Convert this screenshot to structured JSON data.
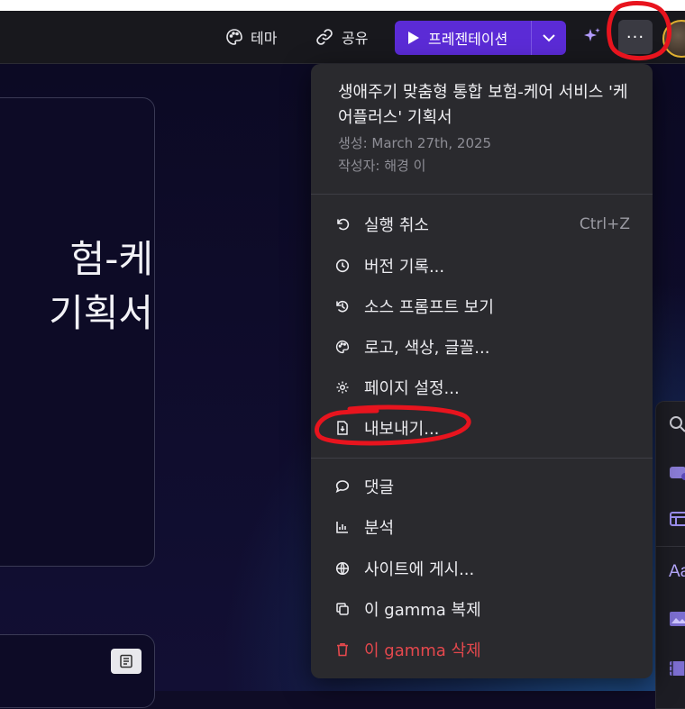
{
  "toolbar": {
    "theme_label": "테마",
    "share_label": "공유",
    "present_label": "프레젠테이션",
    "more_label": "···"
  },
  "slide": {
    "title_line1": "험-케",
    "title_line2": "기획서"
  },
  "menu": {
    "title": "생애주기 맞춤형 통합 보험-케어 서비스 '케어플러스' 기획서",
    "created": "생성: March 27th, 2025",
    "author": "작성자: 해경 이",
    "items": [
      {
        "label": "실행 취소",
        "shortcut": "Ctrl+Z",
        "icon": "undo-icon"
      },
      {
        "label": "버전 기록...",
        "icon": "clock-icon"
      },
      {
        "label": "소스 프롬프트 보기",
        "icon": "history-icon"
      },
      {
        "label": "로고, 색상, 글꼴...",
        "icon": "palette-icon"
      },
      {
        "label": "페이지 설정...",
        "icon": "gear-icon"
      },
      {
        "label": "내보내기...",
        "icon": "export-file-icon"
      },
      {
        "label": "댓글",
        "icon": "comment-icon"
      },
      {
        "label": "분석",
        "icon": "analytics-icon"
      },
      {
        "label": "사이트에 게시...",
        "icon": "globe-icon"
      },
      {
        "label": "이 gamma 복제",
        "icon": "duplicate-icon"
      },
      {
        "label": "이 gamma 삭제",
        "icon": "trash-icon"
      }
    ]
  },
  "side_panel": {
    "text_label": "Aa"
  },
  "colors": {
    "accent": "#5b2bd6",
    "danger": "#e5484d",
    "annotation": "#e8141e"
  }
}
